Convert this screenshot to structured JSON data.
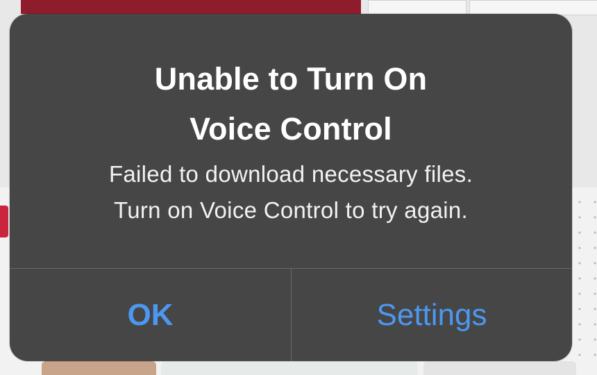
{
  "alert": {
    "title_line1": "Unable to Turn On",
    "title_line2": "Voice Control",
    "message_line1": "Failed to download necessary files.",
    "message_line2": "Turn on Voice Control to try again.",
    "buttons": {
      "ok": "OK",
      "settings": "Settings"
    }
  },
  "colors": {
    "alert_background": "#404040",
    "button_text": "#4c97f0",
    "title_text": "#ffffff"
  }
}
